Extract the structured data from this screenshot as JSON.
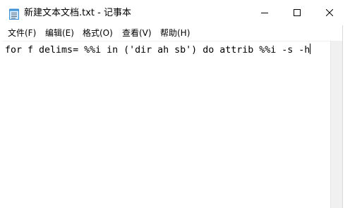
{
  "window": {
    "title": "新建文本文档.txt - 记事本"
  },
  "menu": {
    "file": "文件(F)",
    "edit": "编辑(E)",
    "format": "格式(O)",
    "view": "查看(V)",
    "help": "帮助(H)"
  },
  "editor": {
    "content": "for f delims= %%i in ('dir ah sb') do attrib %%i -s -h"
  },
  "icons": {
    "app": "notepad-icon",
    "minimize": "minimize-icon",
    "maximize": "maximize-icon",
    "close": "close-icon"
  }
}
